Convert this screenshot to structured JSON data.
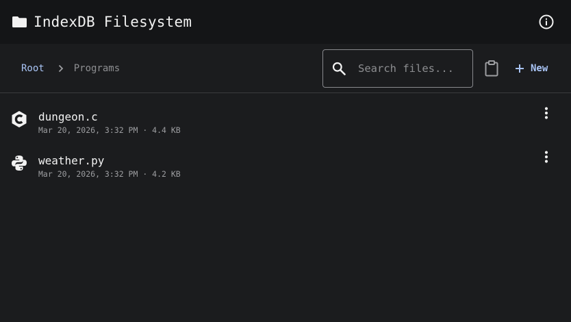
{
  "app": {
    "title": "IndexDB Filesystem",
    "icons": {
      "logo": "folder-icon",
      "info": "info-circle-icon"
    }
  },
  "breadcrumb": {
    "items": [
      "Root",
      "Programs"
    ],
    "separator_icon": "chevron-right-icon"
  },
  "search": {
    "placeholder": "Search files...",
    "value": "",
    "icon": "search-icon"
  },
  "toolbar": {
    "clipboard_icon": "clipboard-icon",
    "new_label": "New",
    "new_icon": "plus-icon"
  },
  "files": [
    {
      "name": "dungeon.c",
      "date": "Mar 20, 2026, 3:32 PM",
      "size": "4.4 KB",
      "meta": "Mar 20, 2026, 3:32 PM · 4.4 KB",
      "icon": "c-language-icon"
    },
    {
      "name": "weather.py",
      "date": "Mar 20, 2026, 3:32 PM",
      "size": "4.2 KB",
      "meta": "Mar 20, 2026, 3:32 PM · 4.2 KB",
      "icon": "python-icon"
    }
  ],
  "colors": {
    "background": "#1b1c1e",
    "appbar": "#141517",
    "accent": "#a9c4f5",
    "muted_text": "#9d9ea1",
    "divider": "#3a3b3e"
  }
}
